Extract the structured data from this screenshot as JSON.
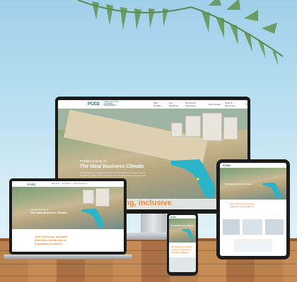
{
  "site": {
    "logo_mark": "PCED",
    "logo_line1": "PINELLAS COUNTY",
    "logo_line2": "ECONOMIC DEVELOPMENT",
    "nav_items": [
      "Why Pinellas",
      "Key Industries",
      "Services & Resources",
      "Opportunities",
      "News & Resources"
    ],
    "hero_subtitle": "Pinellas County, FL",
    "hero_title": "The Ideal Business Climate",
    "hero_description": "Accelerate your company's growth in a pro-business ecosystem along Florida's sparkling Gulf Coast filled with boundless talent opportunities.",
    "tagline_partial": "iving, inclusive",
    "tagline_full_line1": "Join a thriving, inclusive",
    "tagline_full_line2": "business community of",
    "tagline_full_line3": "innovators & leaders"
  },
  "colors": {
    "brand_blue": "#1b5f8c",
    "accent_orange": "#f08c3c",
    "florida_teal": "#2bb3c8"
  },
  "icons": [
    "search-icon",
    "palm-leaf-icon"
  ]
}
